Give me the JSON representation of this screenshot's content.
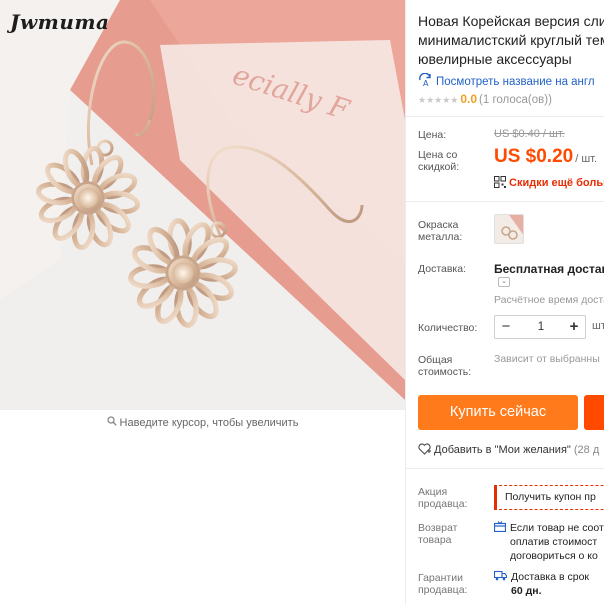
{
  "product_image": {
    "brand": "Jwmuma",
    "zoom_hint": "Наведите курсор, чтобы увеличить",
    "zoom_icon": "magnifier-icon"
  },
  "title": {
    "line1": "Новая Корейская версия слив",
    "line2": "минималистский круглый тем",
    "line3": "ювелирные аксессуары"
  },
  "translate_link": "Посмотреть название на англ",
  "rating": {
    "stars_filled": 0,
    "stars_total": 5,
    "value": "0.0",
    "votes": "(1 голоса(ов))"
  },
  "price": {
    "label": "Цена:",
    "old": "US $0.40 / шт.",
    "discount_label_line1": "Цена со",
    "discount_label_line2": "скидкой:",
    "new_amount": "US $0.20",
    "unit": "/ шт.",
    "discount_link": "Скидки ещё больш"
  },
  "metal_color": {
    "label_line1": "Окраска",
    "label_line2": "металла:"
  },
  "shipping": {
    "label": "Доставка:",
    "value": "Бесплатная доставка",
    "toggle": "⌄",
    "estimate": "Расчётное время доста"
  },
  "quantity": {
    "label": "Количество:",
    "minus": "−",
    "value": "1",
    "plus": "+",
    "unit": "шт"
  },
  "total": {
    "label_line1": "Общая",
    "label_line2": "стоимость:",
    "value": "Зависит от выбранны"
  },
  "buttons": {
    "buy_now": "Купить сейчас"
  },
  "wishlist": {
    "text": "Добавить в \"Мои желания\"",
    "count": "(28 д"
  },
  "seller_promo": {
    "label_line1": "Акция",
    "label_line2": "продавца:",
    "coupon": "Получить купон пр"
  },
  "returns": {
    "label_line1": "Возврат",
    "label_line2": "товара",
    "line1": "Если товар не соот",
    "line2": "оплатив стоимост",
    "line3": "договориться о ко"
  },
  "guarantee": {
    "label_line1": "Гарантии",
    "label_line2": "продавца:",
    "line1": "Доставка в срок",
    "line2": "60 дн."
  },
  "colors": {
    "accent_orange": "#ff7a1a",
    "cart_red": "#ff4a00",
    "price_red": "#ff4a00",
    "link_blue": "#2262c6"
  }
}
